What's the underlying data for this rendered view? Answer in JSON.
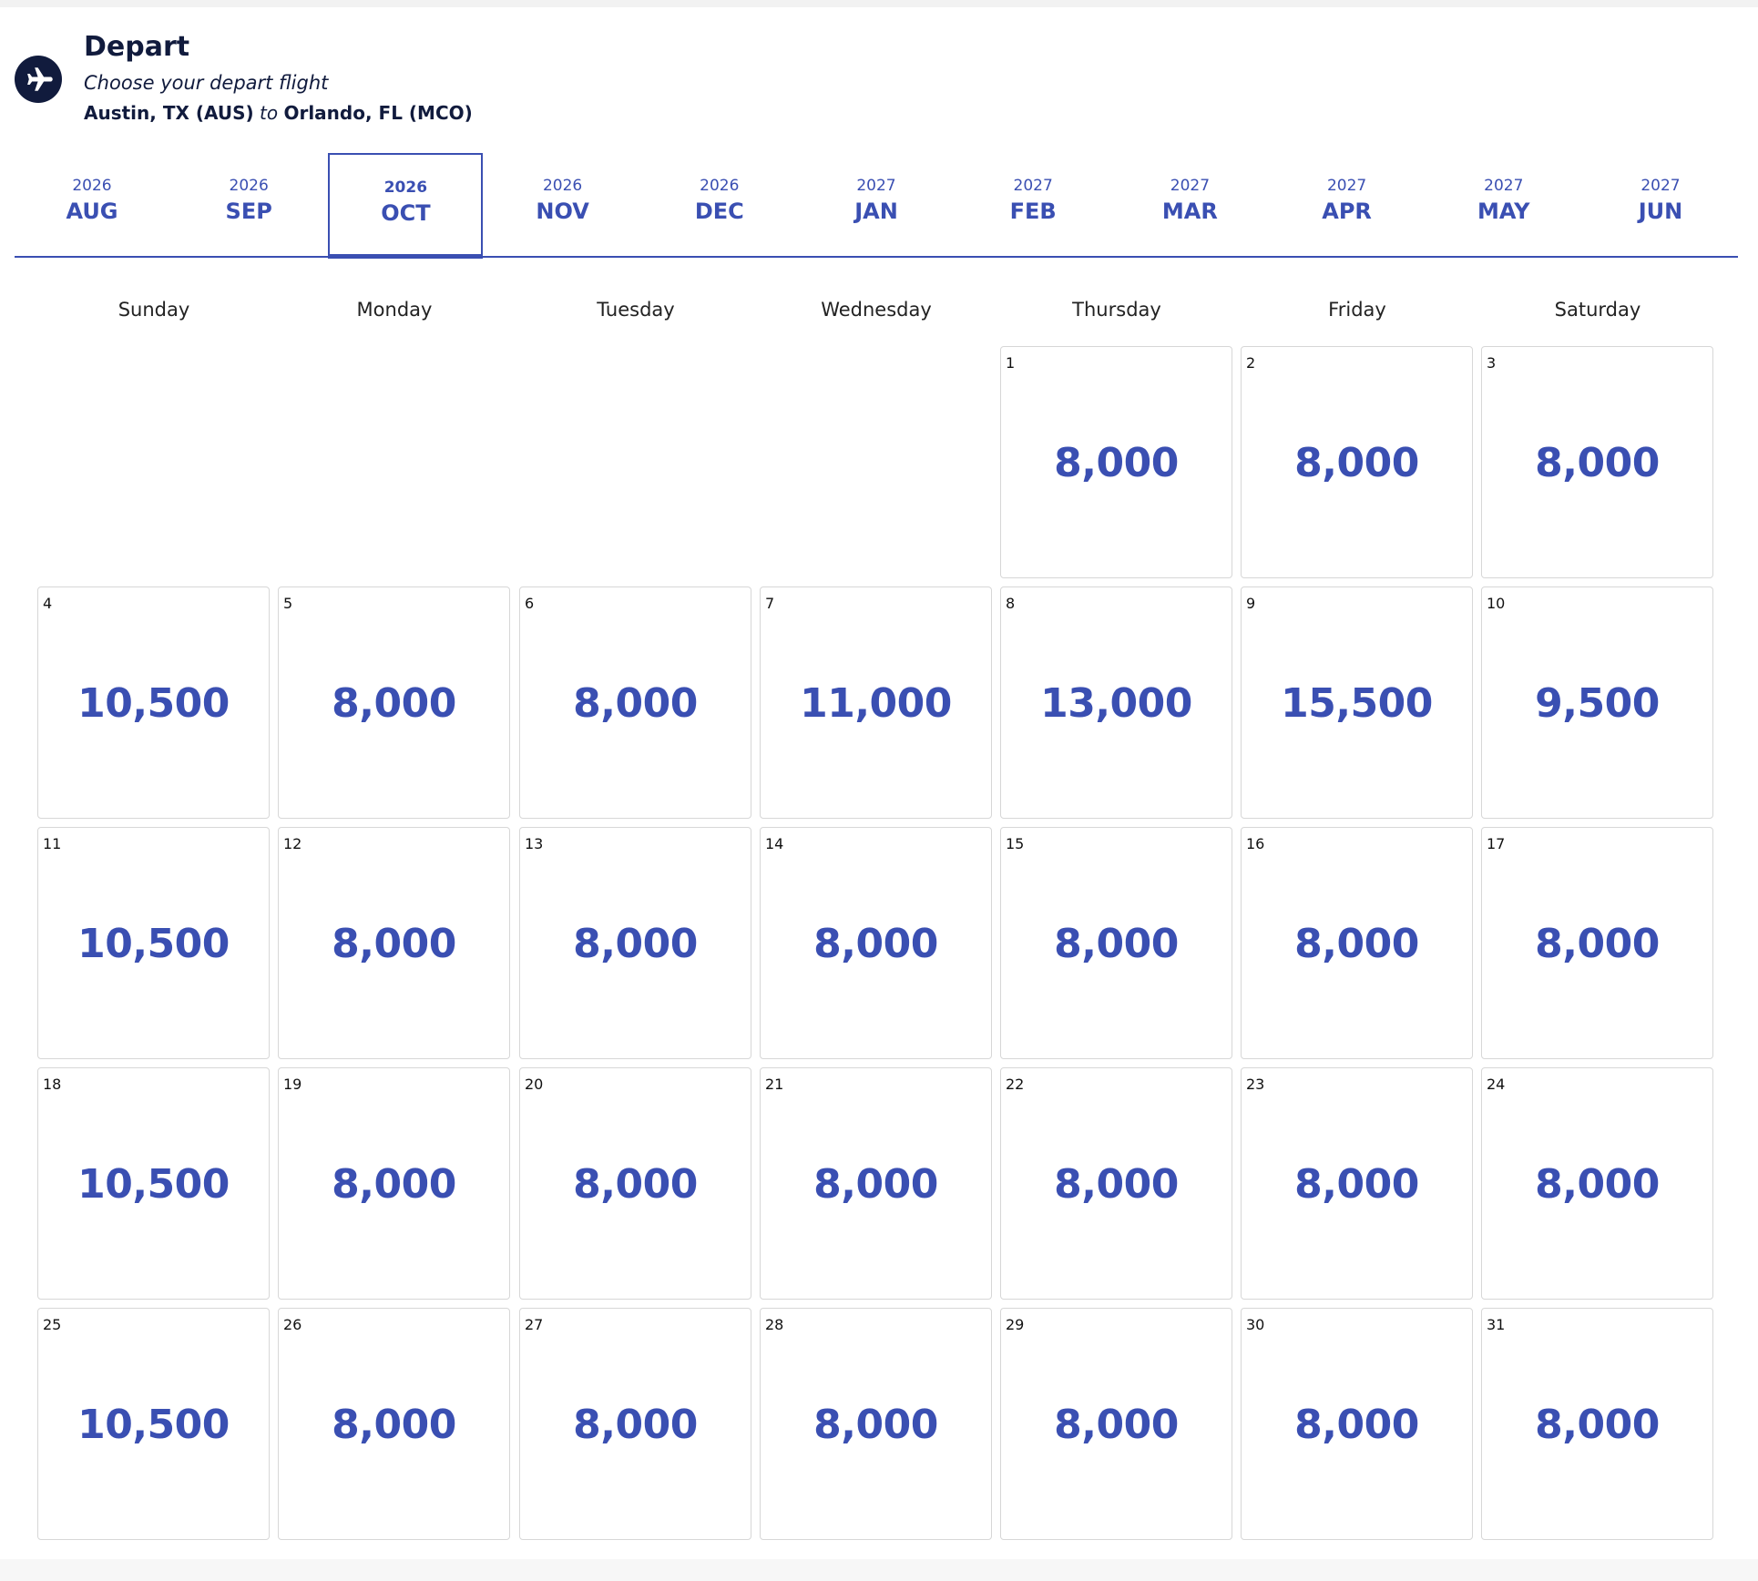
{
  "header": {
    "title": "Depart",
    "subtitle": "Choose your depart flight",
    "origin": "Austin, TX (AUS)",
    "connector": "to",
    "destination": "Orlando, FL (MCO)",
    "icon": "airplane-icon"
  },
  "months": [
    {
      "year": "2026",
      "month": "AUG",
      "active": false
    },
    {
      "year": "2026",
      "month": "SEP",
      "active": false
    },
    {
      "year": "2026",
      "month": "OCT",
      "active": true
    },
    {
      "year": "2026",
      "month": "NOV",
      "active": false
    },
    {
      "year": "2026",
      "month": "DEC",
      "active": false
    },
    {
      "year": "2027",
      "month": "JAN",
      "active": false
    },
    {
      "year": "2027",
      "month": "FEB",
      "active": false
    },
    {
      "year": "2027",
      "month": "MAR",
      "active": false
    },
    {
      "year": "2027",
      "month": "APR",
      "active": false
    },
    {
      "year": "2027",
      "month": "MAY",
      "active": false
    },
    {
      "year": "2027",
      "month": "JUN",
      "active": false
    }
  ],
  "weekdays": [
    "Sunday",
    "Monday",
    "Tuesday",
    "Wednesday",
    "Thursday",
    "Friday",
    "Saturday"
  ],
  "calendar": {
    "first_weekday_index": 4,
    "days": [
      {
        "day": "1",
        "price": "8,000"
      },
      {
        "day": "2",
        "price": "8,000"
      },
      {
        "day": "3",
        "price": "8,000"
      },
      {
        "day": "4",
        "price": "10,500"
      },
      {
        "day": "5",
        "price": "8,000"
      },
      {
        "day": "6",
        "price": "8,000"
      },
      {
        "day": "7",
        "price": "11,000"
      },
      {
        "day": "8",
        "price": "13,000"
      },
      {
        "day": "9",
        "price": "15,500"
      },
      {
        "day": "10",
        "price": "9,500"
      },
      {
        "day": "11",
        "price": "10,500"
      },
      {
        "day": "12",
        "price": "8,000"
      },
      {
        "day": "13",
        "price": "8,000"
      },
      {
        "day": "14",
        "price": "8,000"
      },
      {
        "day": "15",
        "price": "8,000"
      },
      {
        "day": "16",
        "price": "8,000"
      },
      {
        "day": "17",
        "price": "8,000"
      },
      {
        "day": "18",
        "price": "10,500"
      },
      {
        "day": "19",
        "price": "8,000"
      },
      {
        "day": "20",
        "price": "8,000"
      },
      {
        "day": "21",
        "price": "8,000"
      },
      {
        "day": "22",
        "price": "8,000"
      },
      {
        "day": "23",
        "price": "8,000"
      },
      {
        "day": "24",
        "price": "8,000"
      },
      {
        "day": "25",
        "price": "10,500"
      },
      {
        "day": "26",
        "price": "8,000"
      },
      {
        "day": "27",
        "price": "8,000"
      },
      {
        "day": "28",
        "price": "8,000"
      },
      {
        "day": "29",
        "price": "8,000"
      },
      {
        "day": "30",
        "price": "8,000"
      },
      {
        "day": "31",
        "price": "8,000"
      }
    ]
  },
  "colors": {
    "navy": "#111b3d",
    "accent_blue": "#3a4fb2",
    "cell_border": "#d7d7d7"
  }
}
